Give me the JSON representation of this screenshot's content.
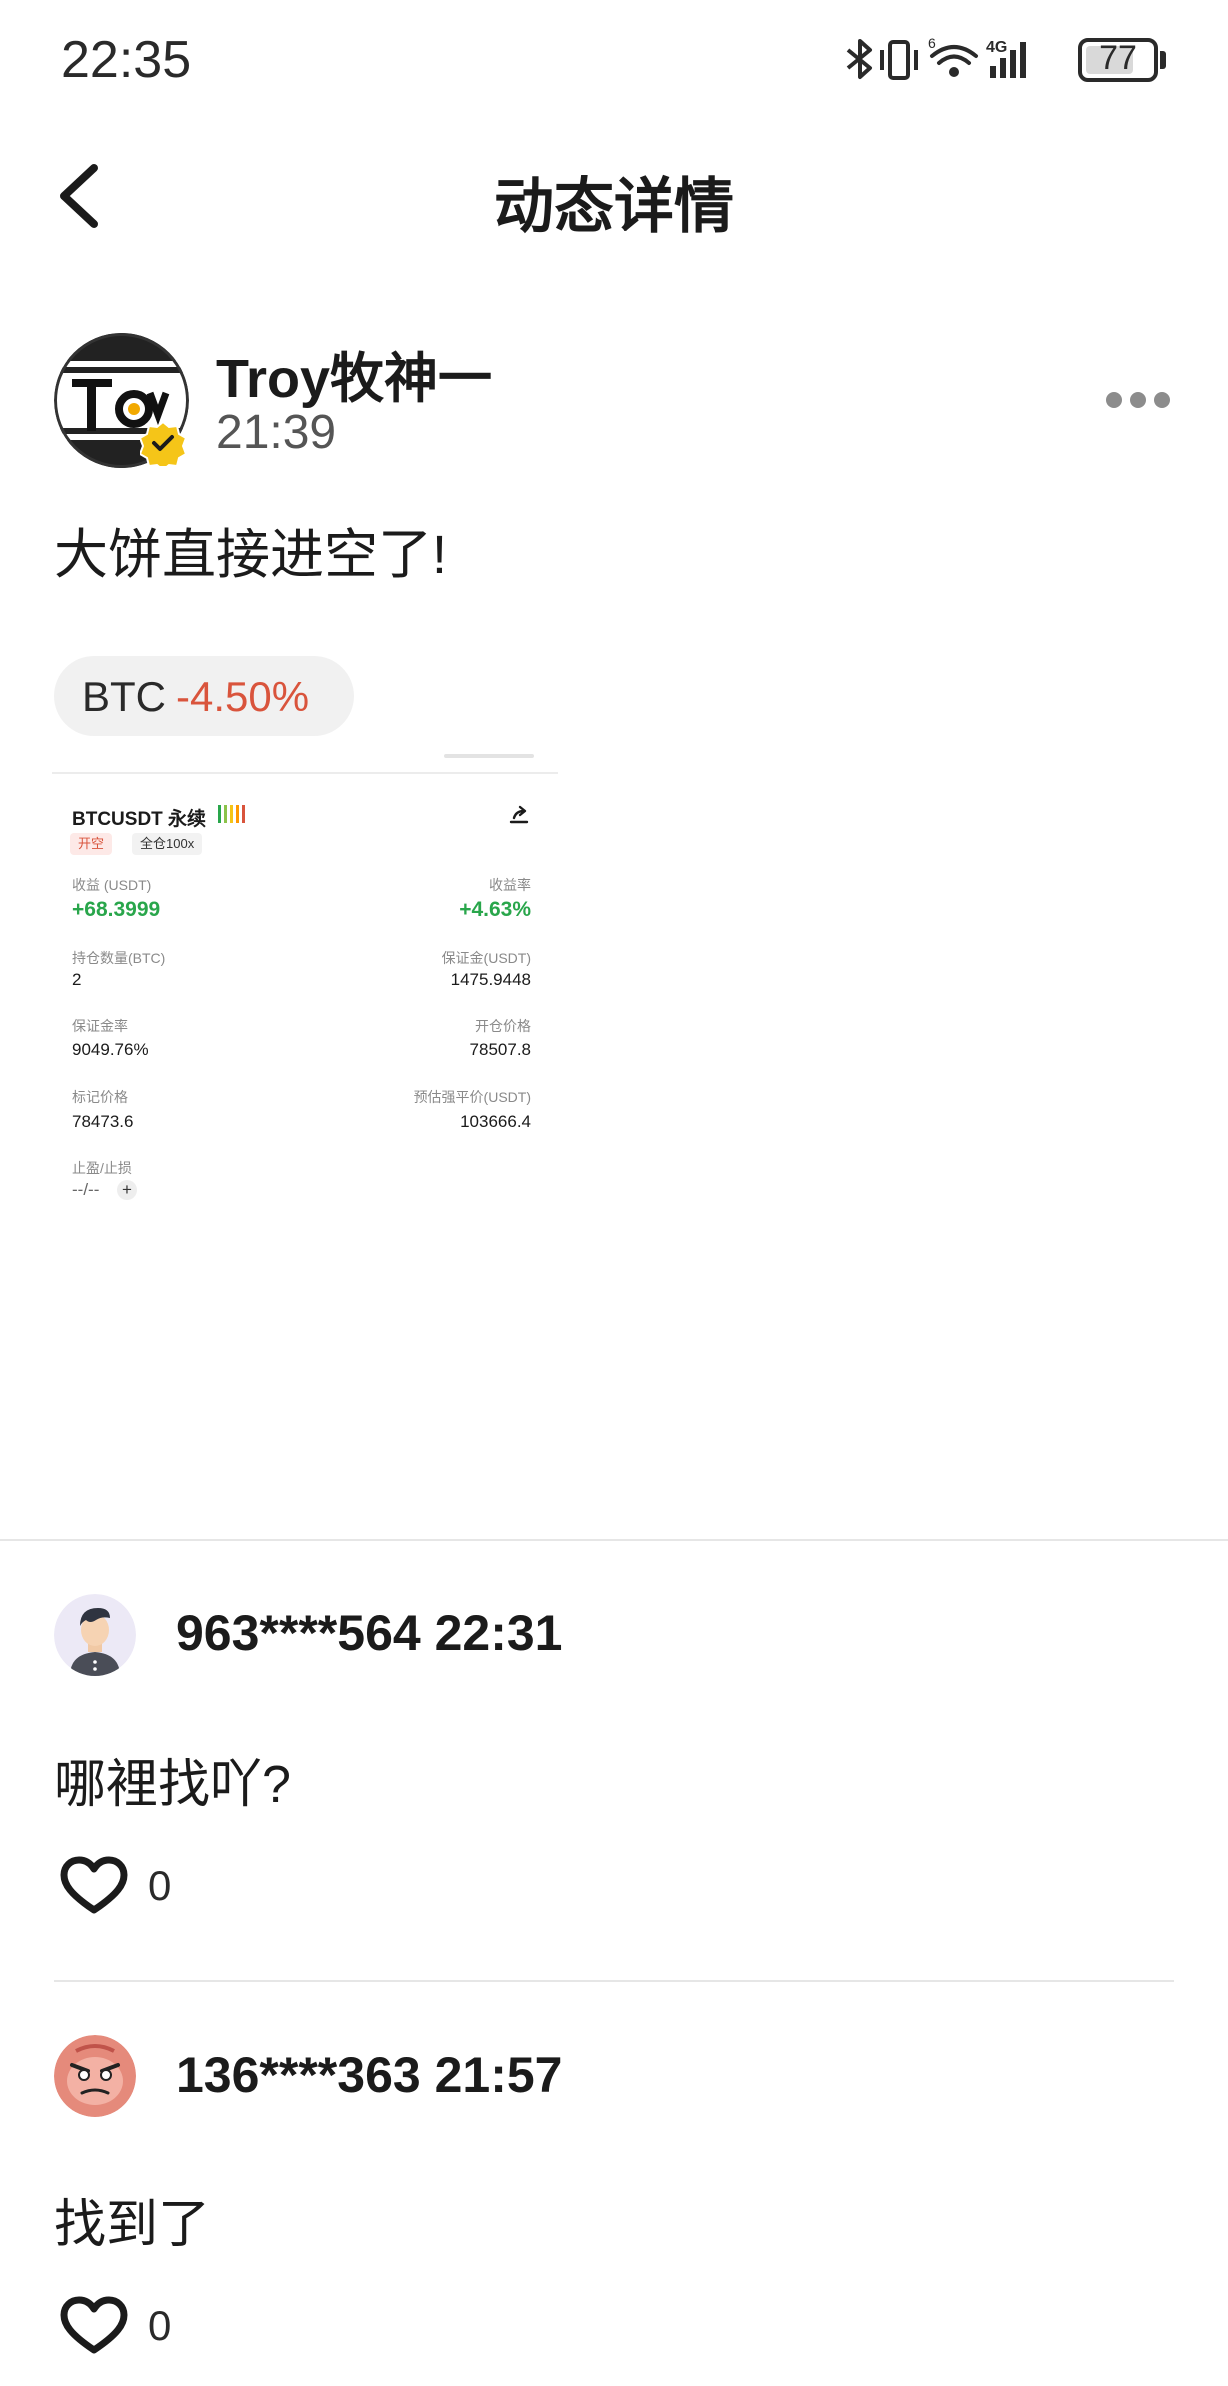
{
  "status_bar": {
    "time": "22:35",
    "battery": "77",
    "battery_level": 0.77
  },
  "nav": {
    "title": "动态详情"
  },
  "post": {
    "author": "Troy牧神一",
    "time": "21:39",
    "text": "大饼直接进空了!",
    "ticker": {
      "symbol": "BTC",
      "change": "-4.50%"
    },
    "position_card": {
      "symbol": "BTCUSDT 永续",
      "side_tag": "开空",
      "mode_tag": "全仓100x",
      "rows": [
        {
          "left_label": "收益 (USDT)",
          "left_value": "+68.3999",
          "right_label": "收益率",
          "right_value": "+4.63%"
        },
        {
          "left_label": "持仓数量(BTC)",
          "left_value": "2",
          "right_label": "保证金(USDT)",
          "right_value": "1475.9448"
        },
        {
          "left_label": "保证金率",
          "left_value": "9049.76%",
          "right_label": "开仓价格",
          "right_value": "78507.8"
        },
        {
          "left_label": "标记价格",
          "left_value": "78473.6",
          "right_label": "预估强平价(USDT)",
          "right_value": "103666.4"
        }
      ],
      "tpsl_label": "止盈/止损",
      "tpsl_value": "--/--",
      "tpsl_add": "+"
    }
  },
  "comments": [
    {
      "user": "963****564",
      "time": "22:31",
      "text": "哪裡找吖?",
      "likes": "0"
    },
    {
      "user": "136****363",
      "time": "21:57",
      "text": "找到了",
      "likes": "0"
    }
  ],
  "colors": {
    "negative": "#d9543c",
    "positive": "#29a64b",
    "badge": "#f5c518"
  }
}
